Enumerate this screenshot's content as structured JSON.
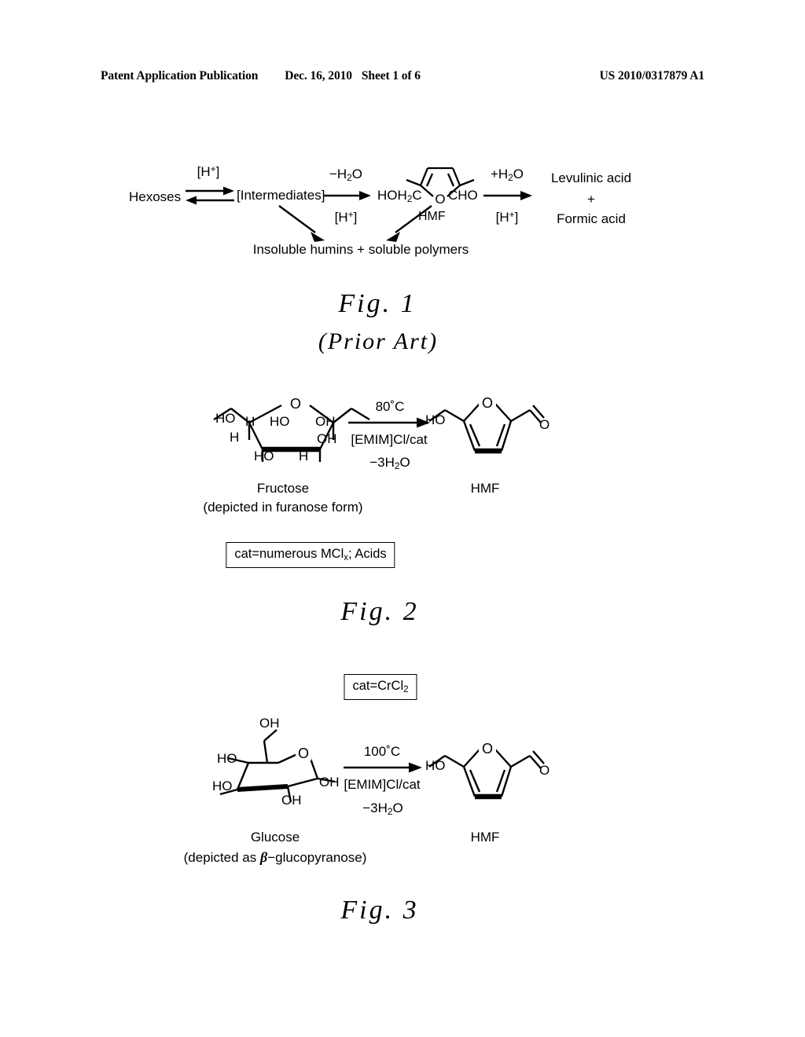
{
  "page": {
    "header": {
      "publication": "Patent Application Publication",
      "date": "Dec. 16, 2010",
      "sheet": "Sheet 1 of 6",
      "patent_number": "US 2010/0317879 A1"
    }
  },
  "figure1": {
    "caption": "Fig.  1",
    "subcaption": "(Prior Art)",
    "reactant": "Hexoses",
    "equilibrium_label": "[H+]",
    "intermediates": "[Intermediates]",
    "dehydration_label": "−H2O",
    "dehydration_catalyst": "[H+]",
    "hmf_left_substituent": "HOH2C",
    "hmf_right_substituent": "CHO",
    "hmf_ring_oxygen": "O",
    "hmf_label": "HMF",
    "hydration_label": "+H2O",
    "hydration_catalyst": "[H+]",
    "product_line1": "Levulinic acid",
    "product_line2": "+",
    "product_line3": "Formic acid",
    "byproducts": "Insoluble humins + soluble polymers"
  },
  "figure2": {
    "caption": "Fig.  2",
    "temperature": "80˚C",
    "solvent": "[EMIM]Cl/cat",
    "water_loss": "−3H2O",
    "reactant_label": "Fructose",
    "reactant_sublabel": "(depicted in furanose form)",
    "product_label": "HMF",
    "catalyst_box": "cat=numerous MClx; Acids",
    "fructose_atoms": {
      "ring_oxygen": "O",
      "c6_hydroxyl": "HO",
      "c3_hydrogen_upper": "H",
      "c2_hydroxyl": "HO",
      "c1_hydroxyl": "OH",
      "c4_hydrogen": "H",
      "c3_hydroxyl": "OH",
      "c4_hydroxyl_lower": "HO",
      "c5_hydrogen_lower": "H"
    },
    "hmf_atoms": {
      "ring_oxygen": "O",
      "hydroxyl": "HO",
      "aldehyde_oxygen": "O"
    }
  },
  "figure3": {
    "caption": "Fig.  3",
    "catalyst_box": "cat=CrCl2",
    "temperature": "100˚C",
    "solvent": "[EMIM]Cl/cat",
    "water_loss": "−3H2O",
    "reactant_label": "Glucose",
    "reactant_sublabel_pre": "(depicted as ",
    "reactant_sublabel_beta": "β",
    "reactant_sublabel_post": "−glucopyranose)",
    "product_label": "HMF",
    "glucose_atoms": {
      "c6_hydroxyl": "OH",
      "ring_oxygen": "O",
      "c4_hydroxyl": "HO",
      "c3_hydroxyl": "HO",
      "c2_hydroxyl": "OH",
      "c1_hydroxyl": "OH"
    },
    "hmf_atoms": {
      "ring_oxygen": "O",
      "hydroxyl": "HO",
      "aldehyde_oxygen": "O"
    }
  }
}
